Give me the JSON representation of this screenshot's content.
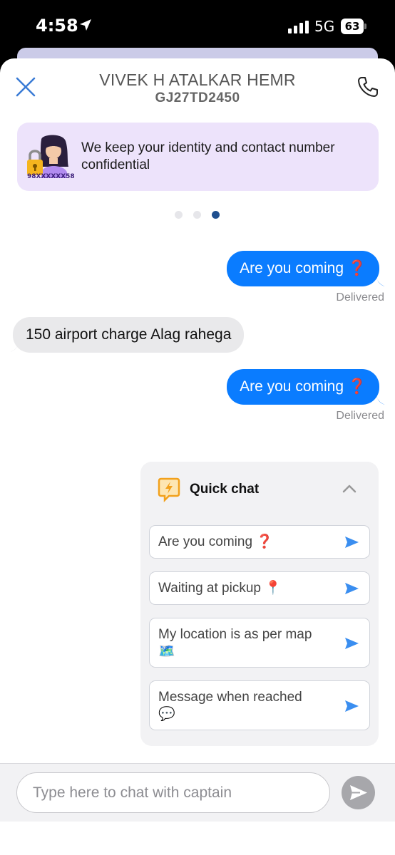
{
  "status_bar": {
    "time": "4:58",
    "network": "5G",
    "battery": "63"
  },
  "header": {
    "driver_name": "VIVEK H ATALKAR HEMR",
    "vehicle_number": "GJ27TD2450"
  },
  "privacy_banner": {
    "text": "We keep your identity and contact number confidential",
    "masked_number": "98XXXXXX58"
  },
  "carousel": {
    "dot_count": 3,
    "active_index": 2
  },
  "messages": [
    {
      "direction": "outgoing",
      "text": "Are you coming ❓",
      "status": "Delivered"
    },
    {
      "direction": "incoming",
      "text": "150 airport charge Alag rahega"
    },
    {
      "direction": "outgoing",
      "text": "Are you coming ❓",
      "status": "Delivered"
    }
  ],
  "quick_chat": {
    "title": "Quick chat",
    "options": [
      {
        "line1": "Are you coming ❓",
        "line2": ""
      },
      {
        "line1": "Waiting at pickup 📍",
        "line2": ""
      },
      {
        "line1": "My location is as per map",
        "line2": "🗺️"
      },
      {
        "line1": "Message when reached",
        "line2": "💬"
      }
    ]
  },
  "composer": {
    "placeholder": "Type here to chat with captain"
  },
  "colors": {
    "outgoing_bubble": "#0a7cff",
    "incoming_bubble": "#e9e9eb",
    "banner_bg": "#ede3fb",
    "accent_blue": "#3a7bd5",
    "active_dot": "#1f4f8f",
    "quick_chat_icon": "#f2a11c"
  }
}
